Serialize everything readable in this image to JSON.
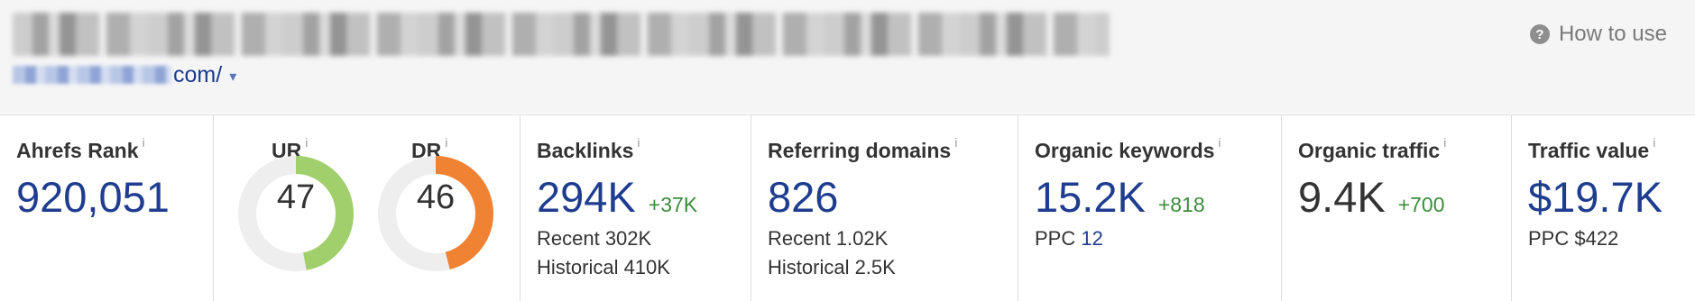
{
  "header": {
    "title_redacted": "",
    "url_suffix": "com/",
    "url_caret": "▾",
    "how_to_use_label": "How to use",
    "help_glyph": "?"
  },
  "colors": {
    "link_blue": "#1f3d8f",
    "positive_green": "#3c8d3c",
    "ur_gauge": "#a0cf6c",
    "dr_gauge": "#ef8233",
    "gauge_track": "#eeeeee"
  },
  "metrics": {
    "ahrefs_rank": {
      "label": "Ahrefs Rank",
      "info": "i",
      "value": "920,051"
    },
    "ur": {
      "label": "UR",
      "info": "i",
      "value": "47",
      "score": 47
    },
    "dr": {
      "label": "DR",
      "info": "i",
      "value": "46",
      "score": 46
    },
    "backlinks": {
      "label": "Backlinks",
      "info": "i",
      "value": "294K",
      "delta": "+37K",
      "recent": "Recent 302K",
      "historical": "Historical 410K"
    },
    "referring_domains": {
      "label": "Referring domains",
      "info": "i",
      "value": "826",
      "recent": "Recent 1.02K",
      "historical": "Historical 2.5K"
    },
    "organic_keywords": {
      "label": "Organic keywords",
      "info": "i",
      "value": "15.2K",
      "delta": "+818",
      "ppc_label": "PPC",
      "ppc_value": "12"
    },
    "organic_traffic": {
      "label": "Organic traffic",
      "info": "i",
      "value": "9.4K",
      "delta": "+700"
    },
    "traffic_value": {
      "label": "Traffic value",
      "info": "i",
      "value": "$19.7K",
      "ppc": "PPC $422"
    }
  }
}
